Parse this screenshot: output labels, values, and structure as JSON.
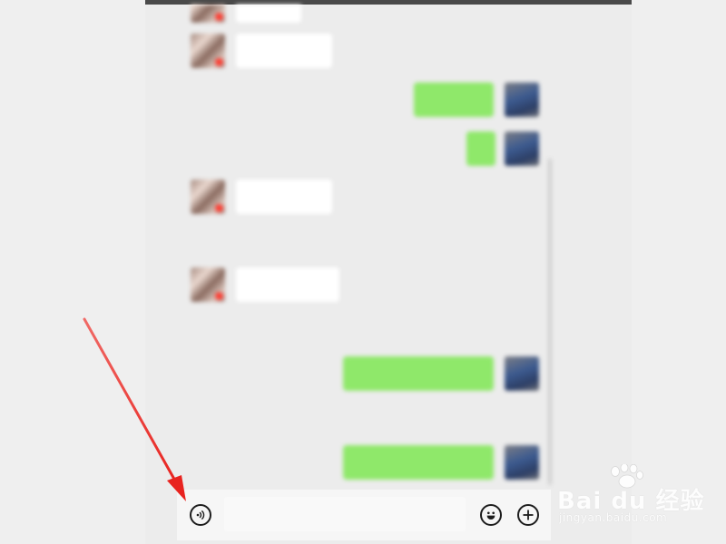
{
  "chat": {
    "messages": [
      {
        "side": "in",
        "text": ""
      },
      {
        "side": "in",
        "text": ""
      },
      {
        "side": "out",
        "text": ""
      },
      {
        "side": "out",
        "text": ""
      },
      {
        "side": "in",
        "text": ""
      },
      {
        "side": "in",
        "text": ""
      },
      {
        "side": "out",
        "text": ""
      },
      {
        "side": "out",
        "text": ""
      }
    ],
    "timestamps": [
      "",
      "",
      ""
    ]
  },
  "input_bar": {
    "voice_icon": "voice-icon",
    "emoji_icon": "emoji-icon",
    "add_icon": "add-icon",
    "text_value": ""
  },
  "annotation": {
    "arrow_color": "#e8231f"
  },
  "colors": {
    "bubble_out": "#8fe86a",
    "bubble_in": "#ffffff",
    "chat_background": "#ececec"
  },
  "watermark": {
    "brand": "Bai du 经验",
    "url": "jingyan.baidu.com"
  }
}
